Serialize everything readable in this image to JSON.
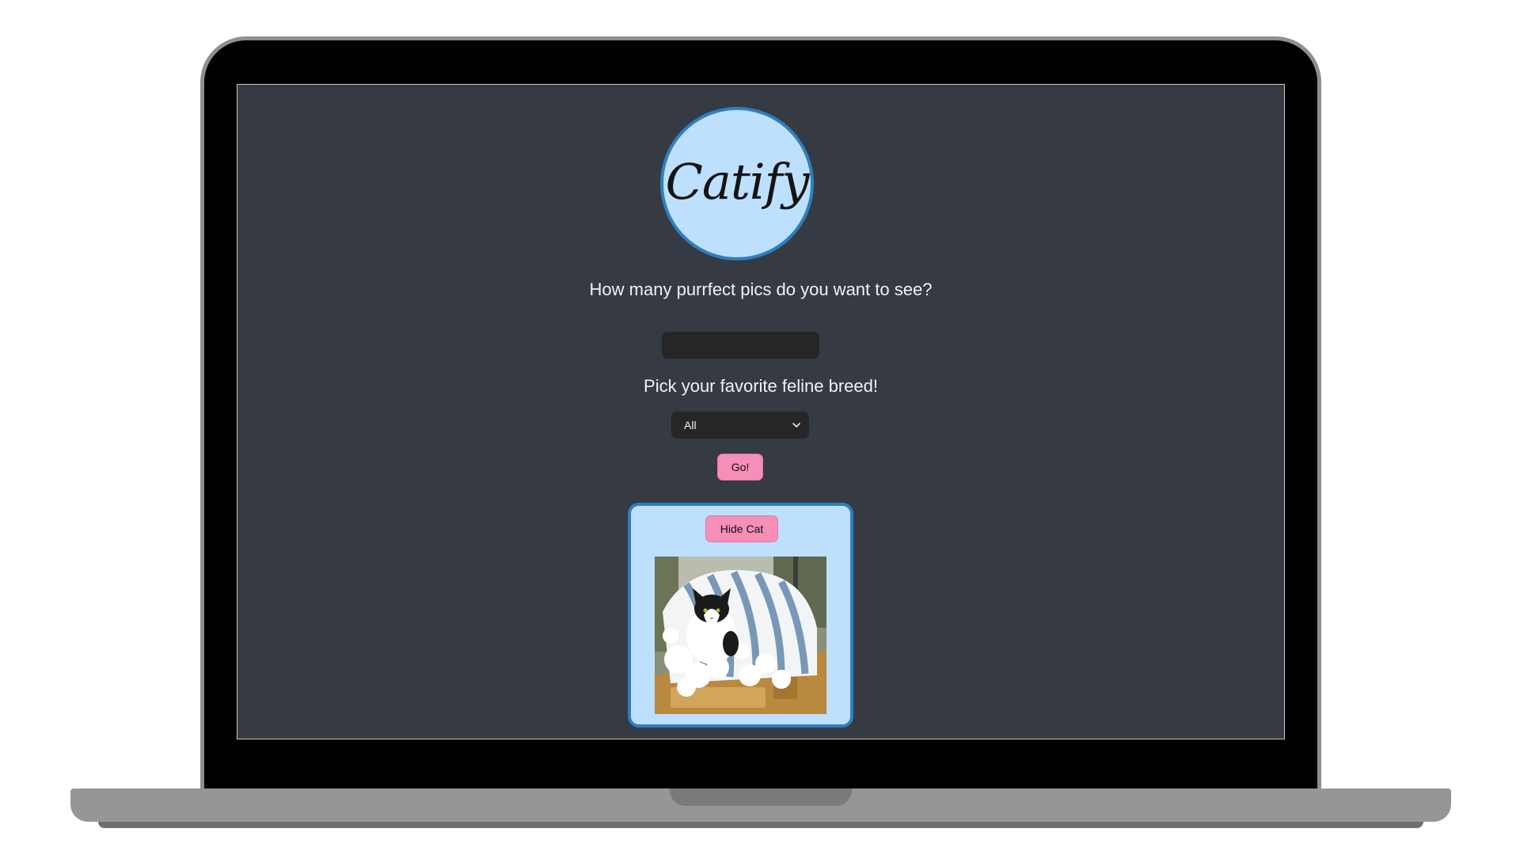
{
  "app": {
    "logo_text": "Catify",
    "count_prompt": "How many purrfect pics do you want to see?",
    "count_input": {
      "value": "",
      "placeholder": ""
    },
    "breed_prompt": "Pick your favorite feline breed!",
    "breed_select": {
      "selected": "All"
    },
    "go_label": "Go!",
    "card": {
      "hide_label": "Hide Cat"
    }
  },
  "colors": {
    "screen_bg": "#353a43",
    "accent_blue": "#bde0fe",
    "border_blue": "#2f7fbd",
    "button_pink": "#f58fb7",
    "input_bg": "#262626"
  },
  "icons": {
    "select_arrow": "chevron-down-icon"
  }
}
